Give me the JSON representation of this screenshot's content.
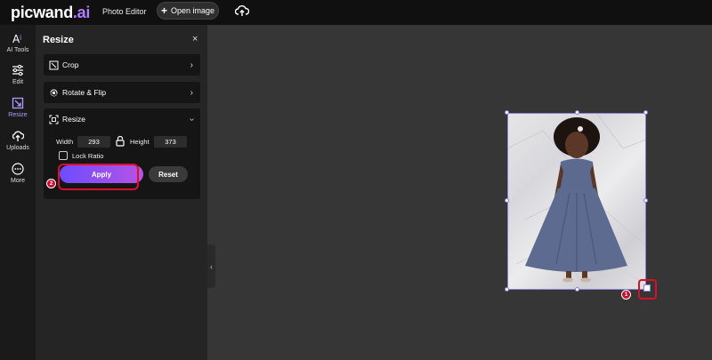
{
  "header": {
    "logo_main": "picwand",
    "logo_suffix": ".ai",
    "menu_photo_editor": "Photo Editor",
    "open_image_label": "Open image",
    "cloud_icon": "cloud-upload-icon"
  },
  "sidebar": {
    "items": [
      {
        "label": "AI Tools",
        "icon": "ai-tools-icon"
      },
      {
        "label": "Edit",
        "icon": "sliders-icon"
      },
      {
        "label": "Resize",
        "icon": "resize-icon"
      },
      {
        "label": "Uploads",
        "icon": "cloud-upload-icon"
      },
      {
        "label": "More",
        "icon": "more-icon"
      }
    ],
    "active": "Resize"
  },
  "panel": {
    "title": "Resize",
    "close": "×",
    "sections": {
      "crop": "Crop",
      "rotate": "Rotate & Flip",
      "resize": "Resize"
    },
    "width_label": "Width",
    "width_value": "293",
    "height_label": "Height",
    "height_value": "373",
    "lock_ratio_label": "Lock Ratio",
    "lock_ratio_checked": false,
    "apply_label": "Apply",
    "reset_label": "Reset"
  },
  "annotations": {
    "badge_1": "1",
    "badge_2": "2"
  },
  "colors": {
    "accent": "#8b7fd6",
    "highlight": "#d8102a",
    "apply_gradient_start": "#6e4cff",
    "apply_gradient_end": "#b653e6"
  }
}
